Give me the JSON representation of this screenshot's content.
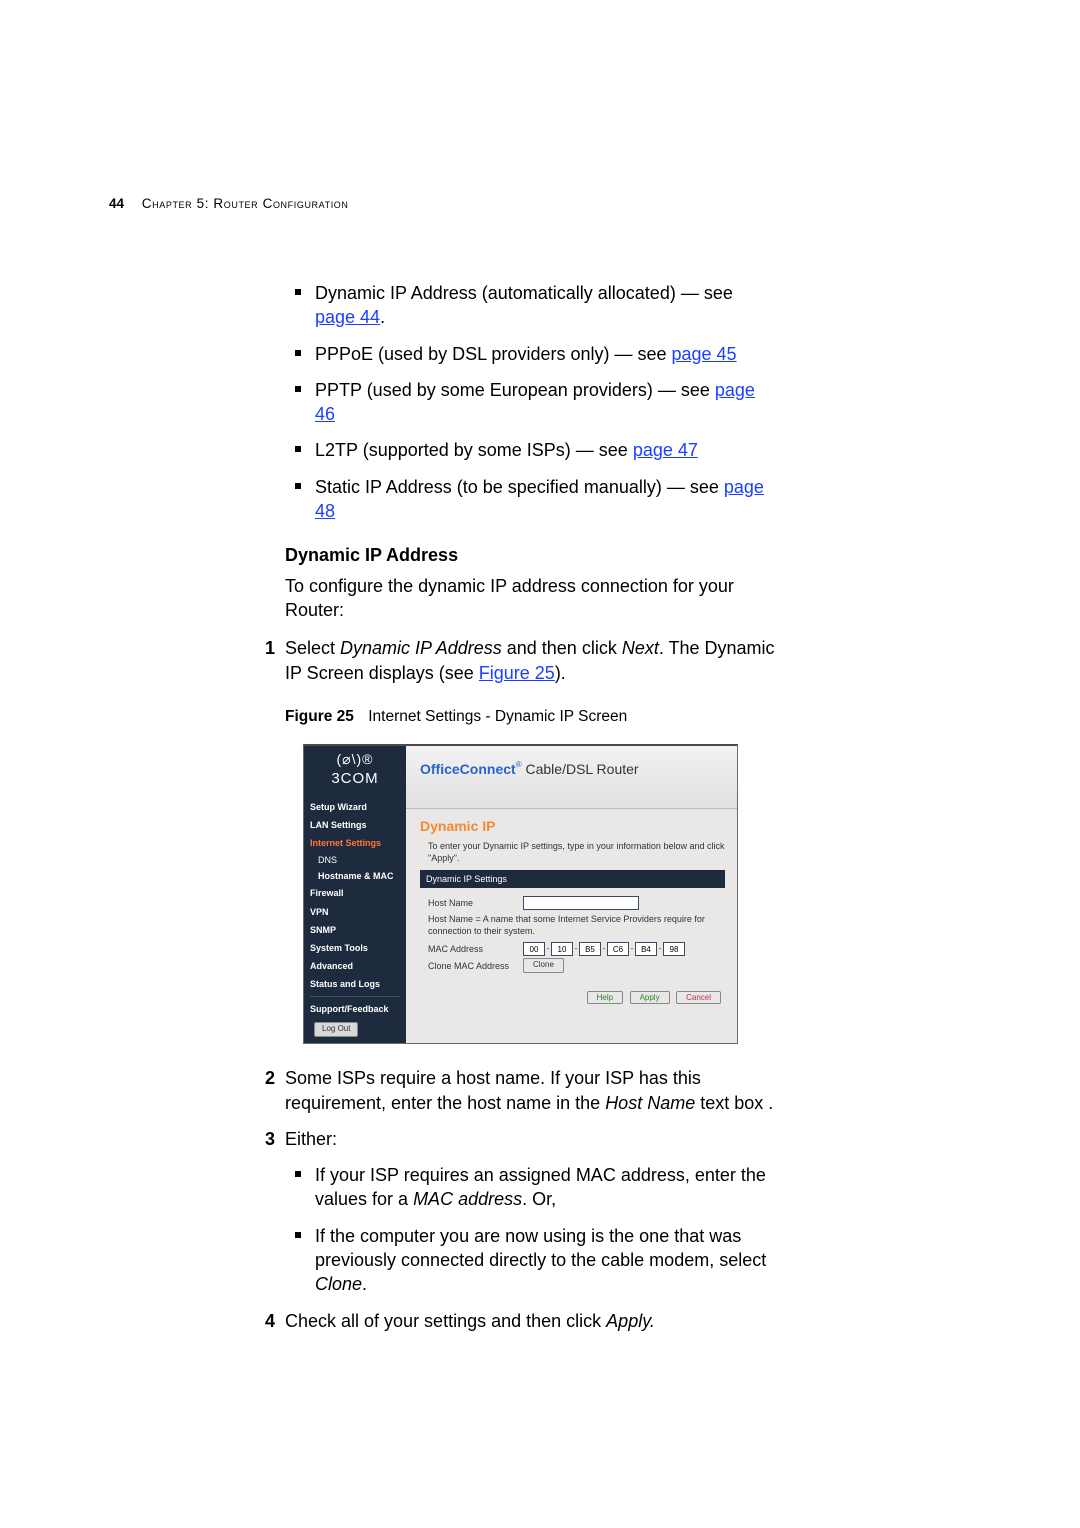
{
  "page_header": {
    "page_number": "44",
    "chapter": "Chapter 5: Router Configuration"
  },
  "intro_bullets": [
    {
      "text": "Dynamic IP Address (automatically allocated) — see ",
      "link": "page 44",
      "after": "."
    },
    {
      "text": "PPPoE (used by DSL providers only) — see ",
      "link": "page 45",
      "after": ""
    },
    {
      "text": "PPTP (used by some European providers) — see ",
      "link": "page 46",
      "after": ""
    },
    {
      "text": "L2TP (supported by some ISPs) — see ",
      "link": "page 47",
      "after": ""
    },
    {
      "text": "Static IP Address (to be specified manually) — see ",
      "link": "page 48",
      "after": ""
    }
  ],
  "section_heading": "Dynamic IP Address",
  "section_intro": "To configure the dynamic IP address connection for your Router:",
  "step1": {
    "num": "1",
    "prefix": "Select ",
    "em1": "Dynamic IP Address",
    "mid": " and then click ",
    "em2": "Next",
    "suffix1": ". The Dynamic IP Screen displays (see ",
    "figlink": "Figure 25",
    "suffix2": ")."
  },
  "figure": {
    "label": "Figure 25",
    "title": "Internet Settings - Dynamic IP Screen"
  },
  "screenshot": {
    "brand_top": "(⌀\\)®",
    "brand": "3COM",
    "product_brand": "OfficeConnect",
    "product_rest": " Cable/DSL Router",
    "sidebar": {
      "items": [
        {
          "label": "Setup Wizard",
          "type": "item",
          "bold": true
        },
        {
          "label": "LAN Settings",
          "type": "item",
          "bold": true
        },
        {
          "label": "Internet Settings",
          "type": "item",
          "bold": true,
          "active": true
        },
        {
          "label": "DNS",
          "type": "sub"
        },
        {
          "label": "Hostname & MAC",
          "type": "sub",
          "bold": true
        },
        {
          "label": "Firewall",
          "type": "item",
          "bold": true
        },
        {
          "label": "VPN",
          "type": "item",
          "bold": true
        },
        {
          "label": "SNMP",
          "type": "item",
          "bold": true
        },
        {
          "label": "System Tools",
          "type": "item",
          "bold": true
        },
        {
          "label": "Advanced",
          "type": "item",
          "bold": true
        },
        {
          "label": "Status and Logs",
          "type": "item",
          "bold": true
        }
      ],
      "support": "Support/Feedback",
      "logout": "Log Out"
    },
    "main": {
      "title": "Dynamic IP",
      "intro": "To enter your Dynamic IP settings, type in your information below and click \"Apply\".",
      "settings_bar": "Dynamic IP Settings",
      "host_label": "Host Name",
      "host_note": "Host Name = A name that some Internet Service Providers require for connection to their system.",
      "mac_label": "MAC Address",
      "mac": [
        "00",
        "10",
        "B5",
        "C6",
        "B4",
        "98"
      ],
      "mac_sep": "-",
      "clone_label": "Clone MAC Address",
      "clone_btn": "Clone",
      "help_btn": "Help",
      "apply_btn": "Apply",
      "cancel_btn": "Cancel"
    }
  },
  "step2": {
    "num": "2",
    "t1": "Some ISPs require a host name. If your ISP has this requirement, enter the host name in the ",
    "em": "Host Name",
    "t2": " text box ."
  },
  "step3": {
    "num": "3",
    "lead": "Either:",
    "bullets": [
      {
        "t1": "If your ISP requires an assigned MAC address, enter the values for a ",
        "em": "MAC address",
        "t2": ". Or,"
      },
      {
        "t1": "If the computer you are now using is the one that was previously connected directly to the cable modem, select ",
        "em": "Clone",
        "t2": "."
      }
    ]
  },
  "step4": {
    "num": "4",
    "t1": "Check all of your settings and then click ",
    "em": "Apply.",
    "t2": ""
  }
}
